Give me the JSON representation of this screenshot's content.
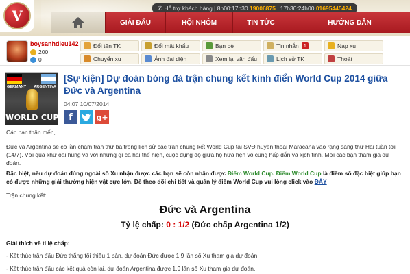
{
  "header": {
    "logo_letter": "V",
    "hotline_prefix": "Hỗ trợ khách hàng",
    "hours1": "8h00:17h30",
    "phone1": "19006875",
    "hours2": "17h30:24h00",
    "phone2": "01695445424"
  },
  "nav": {
    "items": [
      {
        "label": "GIẢI ĐẤU"
      },
      {
        "label": "HỘI NHÓM"
      },
      {
        "label": "TIN TỨC"
      },
      {
        "label": "HƯỚNG DẪN"
      }
    ]
  },
  "user": {
    "name": "boysanhdieu142",
    "xu": "200",
    "points": "0"
  },
  "quick_actions": [
    {
      "label": "Đổi tên TK",
      "icon": "edit-icon"
    },
    {
      "label": "Đổi mật khẩu",
      "icon": "key-icon"
    },
    {
      "label": "Bạn bè",
      "icon": "friends-icon"
    },
    {
      "label": "Tin nhắn",
      "icon": "mail-icon",
      "badge": "1"
    },
    {
      "label": "Nạp xu",
      "icon": "coin-icon"
    },
    {
      "label": "Chuyển xu",
      "icon": "transfer-icon"
    },
    {
      "label": "Ảnh đại diện",
      "icon": "image-icon"
    },
    {
      "label": "Xem lại văn đấu",
      "icon": "replay-icon"
    },
    {
      "label": "Lịch sử TK",
      "icon": "history-icon"
    },
    {
      "label": "Thoát",
      "icon": "logout-icon"
    }
  ],
  "article": {
    "thumb_text": "WORLD CUP",
    "thumb_country1": "GERMANY",
    "thumb_country2": "ARGENTINA",
    "title": "[Sự kiện] Dự đoán bóng đá trận chung kết kinh điển World Cup 2014 giữa Đức và Argentina",
    "date": "04:07 10/07/2014",
    "greeting": "Các bạn thân mến,",
    "para1": "Đức và Argentina sẽ có lần chạm trán thứ ba trong lịch sử các trận chung kết World Cup tại SVĐ huyền thoại Maracana vào rạng sáng thứ Hai tuần tới (14/7). Với quá khứ oai hùng và với những gì cả hai thể hiện, cuộc đụng độ giữa họ hứa hẹn vô cùng hấp dẫn và kịch tính. Mời các bạn tham gia dự đoán.",
    "para2_a": "Đặc biệt, nếu dự đoán đúng ngoài số Xu nhận được các bạn sẽ còn nhận được ",
    "para2_g1": "Điểm World Cup",
    "para2_sep": ". ",
    "para2_g2": "Điểm World Cup",
    "para2_b": " là điểm số đặc biệt giúp bạn có được những giải thưởng hiện vật cực lớn. Để theo dõi chi tiết và quản lý điểm World Cup vui lòng click vào ",
    "para2_link": "ĐÂY",
    "match_label": "Trận chung kết:",
    "match": "Đức và Argentina",
    "odds_prefix": "Tỷ lệ chấp: ",
    "odds_value": "0 : 1/2",
    "odds_suffix": " (Đức chấp Argentina 1/2)",
    "rules_heading": "Giải thích về tỉ lệ chấp:",
    "rule1": "- Kết thúc trận đấu Đức thắng tối thiểu 1 bàn, dự đoán Đức được 1.9 lần số Xu tham gia dự đoán.",
    "rule2": "- Kết thúc trận đấu các kết quả còn lại, dự đoán Argentina được 1.9 lần số Xu tham gia dự đoán."
  },
  "colors": {
    "nav_red": "#b3222a",
    "title_blue": "#1c4fa0",
    "odds_red": "#d40000",
    "highlight_green": "#2e8b2e",
    "facebook": "#3b5998",
    "twitter": "#2aa9e0",
    "gplus": "#dd4b39"
  }
}
